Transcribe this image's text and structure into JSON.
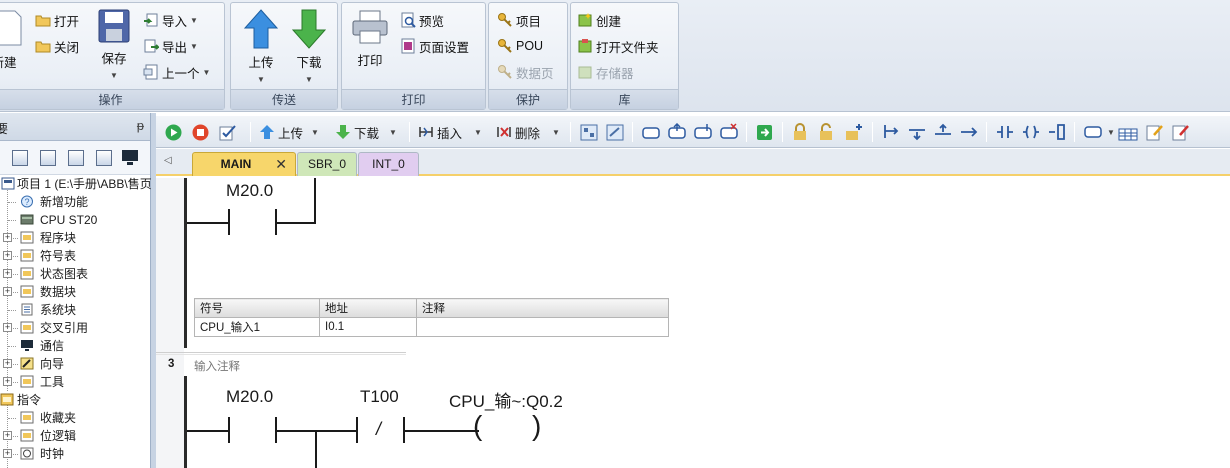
{
  "ribbon": {
    "groups": [
      {
        "label": "操作"
      },
      {
        "label": "传送"
      },
      {
        "label": "打印"
      },
      {
        "label": "保护"
      },
      {
        "label": "库"
      }
    ],
    "operate": {
      "new": "新建",
      "open": "打开",
      "close": "关闭",
      "save": "保存",
      "import": "导入",
      "export": "导出",
      "prev": "上一个"
    },
    "transfer": {
      "upload": "上传",
      "download": "下载"
    },
    "print": {
      "print": "打印",
      "preview": "预览",
      "page_setup": "页面设置"
    },
    "protect": {
      "project": "项目",
      "pou": "POU",
      "data_page": "数据页"
    },
    "library": {
      "create": "创建",
      "open_folder": "打开文件夹",
      "memory": "存储器"
    }
  },
  "left_panel": {
    "title_fragment": "要",
    "pin_icon": "pin-icon",
    "tree": [
      {
        "label": "项目 1 (E:\\手册\\ABB\\售页",
        "icon": "project-icon"
      },
      {
        "label": "新增功能",
        "icon": "help-icon"
      },
      {
        "label": "CPU ST20",
        "icon": "cpu-icon"
      },
      {
        "label": "程序块",
        "icon": "folder-icon"
      },
      {
        "label": "符号表",
        "icon": "folder-icon"
      },
      {
        "label": "状态图表",
        "icon": "folder-icon"
      },
      {
        "label": "数据块",
        "icon": "folder-icon"
      },
      {
        "label": "系统块",
        "icon": "system-block-icon"
      },
      {
        "label": "交叉引用",
        "icon": "folder-icon"
      },
      {
        "label": "通信",
        "icon": "comm-icon"
      },
      {
        "label": "向导",
        "icon": "wizard-icon"
      },
      {
        "label": "工具",
        "icon": "folder-icon"
      },
      {
        "label": "指令",
        "icon": "instructions-icon"
      },
      {
        "label": "收藏夹",
        "icon": "folder-icon"
      },
      {
        "label": "位逻辑",
        "icon": "folder-icon"
      },
      {
        "label": "时钟",
        "icon": "clock-icon"
      }
    ]
  },
  "editor_toolbar": {
    "upload": "上传",
    "download": "下载",
    "insert": "插入",
    "delete": "删除"
  },
  "tabs": [
    {
      "label": "MAIN",
      "active": true,
      "color": "#f7d66b"
    },
    {
      "label": "SBR_0",
      "active": false,
      "color": "#cfe7b8"
    },
    {
      "label": "INT_0",
      "active": false,
      "color": "#e1cdf0"
    }
  ],
  "ladder": {
    "network2": {
      "contact_address": "M20.0",
      "symbol_table": {
        "headers": [
          "符号",
          "地址",
          "注释"
        ],
        "rows": [
          [
            "CPU_输入1",
            "I0.1",
            ""
          ]
        ]
      }
    },
    "network3": {
      "number": "3",
      "comment": "输入注释",
      "contact1": "M20.0",
      "contact2": "T100",
      "contact2_sign": "/",
      "coil": "CPU_输~:Q0.2"
    }
  }
}
